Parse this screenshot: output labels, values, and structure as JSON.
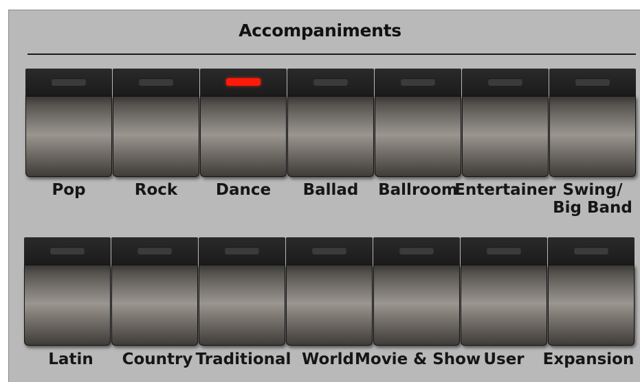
{
  "panel": {
    "title": "Accompaniments",
    "led_on_color": "#ff1a0a",
    "led_off_color": "#3b3b3b"
  },
  "row1": [
    {
      "label": "Pop",
      "active": false
    },
    {
      "label": "Rock",
      "active": false
    },
    {
      "label": "Dance",
      "active": true
    },
    {
      "label": "Ballad",
      "active": false
    },
    {
      "label": "Ballroom",
      "active": false
    },
    {
      "label": "Entertainer",
      "active": false
    },
    {
      "label": "Swing/",
      "label2": "Big Band",
      "active": false
    }
  ],
  "row2": [
    {
      "label": "Latin",
      "active": false
    },
    {
      "label": "Country",
      "active": false
    },
    {
      "label": "Traditional",
      "active": false
    },
    {
      "label": "World",
      "active": false
    },
    {
      "label": "Movie & Show",
      "active": false
    },
    {
      "label": "User",
      "active": false
    },
    {
      "label": "Expansion",
      "active": false
    }
  ]
}
